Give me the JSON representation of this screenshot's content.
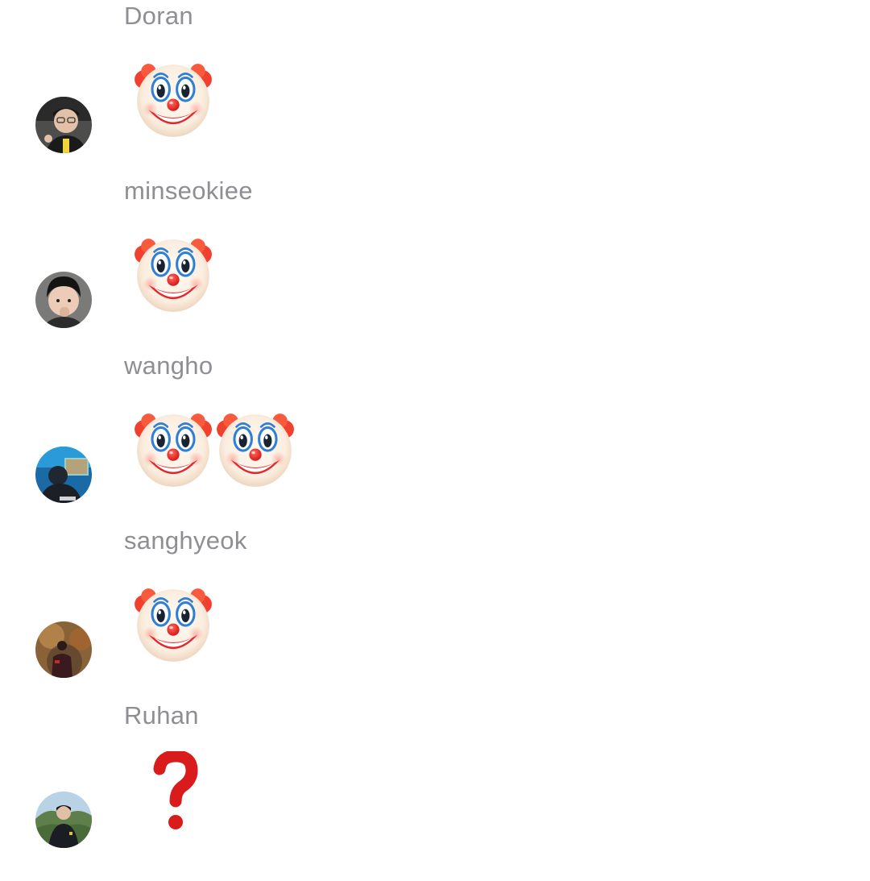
{
  "chat": {
    "messages": [
      {
        "sender": "Doran",
        "content": [
          "clown-face-emoji"
        ],
        "avatar": {
          "icon": "person-avatar",
          "bg": "#5a5a58",
          "accent": "#d9b8a0"
        }
      },
      {
        "sender": "minseokiee",
        "content": [
          "clown-face-emoji"
        ],
        "avatar": {
          "icon": "person-avatar",
          "bg": "#6b6b6b",
          "accent": "#e8c9b3"
        }
      },
      {
        "sender": "wangho",
        "content": [
          "clown-face-emoji",
          "clown-face-emoji"
        ],
        "avatar": {
          "icon": "person-avatar",
          "bg": "#1e6fa8",
          "accent": "#2a3440"
        }
      },
      {
        "sender": "sanghyeok",
        "content": [
          "clown-face-emoji"
        ],
        "avatar": {
          "icon": "person-avatar",
          "bg": "#8a5a2e",
          "accent": "#3a1e22"
        }
      },
      {
        "sender": "Ruhan",
        "content": [
          "question-mark-emoji"
        ],
        "avatar": {
          "icon": "person-avatar",
          "bg": "#6f8f5a",
          "accent": "#1a1e24"
        }
      }
    ]
  },
  "colors": {
    "name_text": "#8e8e93",
    "background": "#ffffff",
    "question_red": "#e0201b"
  }
}
